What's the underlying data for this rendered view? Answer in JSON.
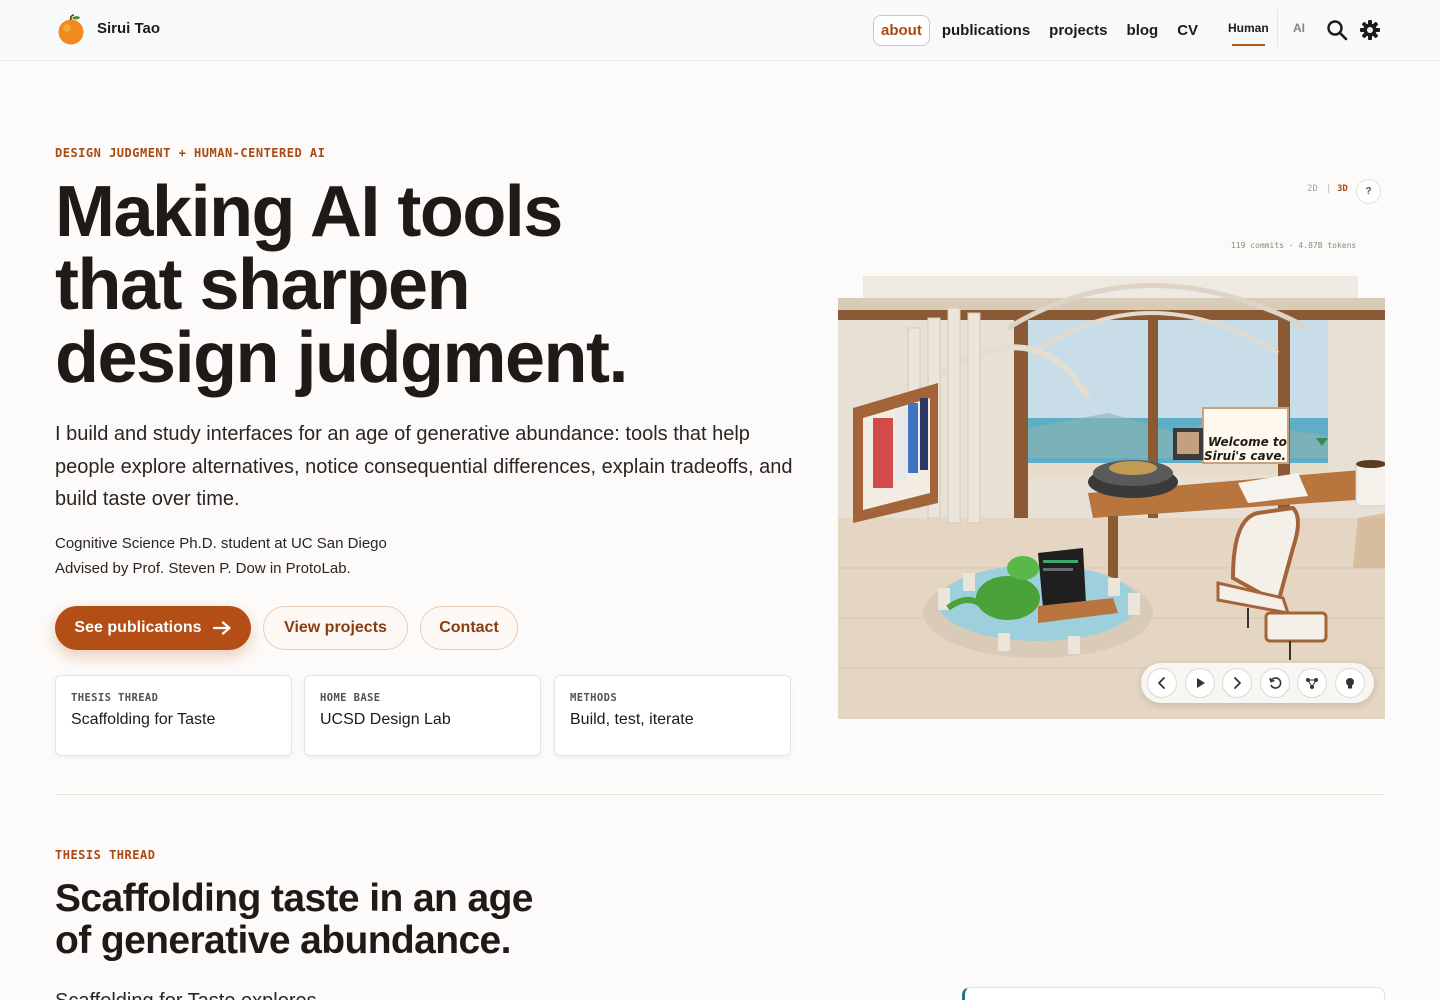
{
  "nav": {
    "brand": "Sirui Tao",
    "links": [
      {
        "label": "about",
        "active": true
      },
      {
        "label": "publications"
      },
      {
        "label": "projects"
      },
      {
        "label": "blog"
      },
      {
        "label": "CV"
      }
    ],
    "modes": {
      "human": "Human",
      "ai": "AI",
      "selected": "Human"
    },
    "icons": [
      "search-icon",
      "gear-icon"
    ]
  },
  "hero": {
    "eyebrow": "DESIGN JUDGMENT + HUMAN-CENTERED AI",
    "title_lines": [
      "Making AI tools",
      "that sharpen",
      "design judgment."
    ],
    "lead": "I build and study interfaces for an age of generative abundance: tools that help people explore alternatives, notice consequential differences, explain tradeoffs, and build taste over time.",
    "meta_line1": "Cognitive Science Ph.D. student at UC San Diego",
    "meta_line2": "Advised by Prof. Steven P. Dow in ProtoLab.",
    "buttons": {
      "primary": "See publications",
      "projects": "View projects",
      "contact": "Contact"
    },
    "cards": [
      {
        "label": "THESIS THREAD",
        "value": "Scaffolding for Taste"
      },
      {
        "label": "HOME BASE",
        "value": "UCSD Design Lab"
      },
      {
        "label": "METHODS",
        "value": "Build, test, iterate"
      }
    ]
  },
  "scene": {
    "toggle_2d": "2D",
    "toggle_sep": "|",
    "toggle_3d": "3D",
    "toggle_selected": "3D",
    "help": "?",
    "stats": "119 commits · 4.87B tokens",
    "sign_line1": "Welcome to",
    "sign_line2": "Sirui's cave.",
    "controls": [
      "prev-icon",
      "play-icon",
      "next-icon",
      "reset-icon",
      "graph-icon",
      "lightbulb-icon"
    ]
  },
  "section": {
    "eyebrow": "THESIS THREAD",
    "title_line1": "Scaffolding taste in an age",
    "title_line2": "of generative abundance.",
    "body_start": "Scaffolding for Taste explores..."
  },
  "colors": {
    "accent": "#b24e16",
    "accent_text": "#a84a12",
    "ink": "#1f1a17",
    "background": "#fdfbf9"
  }
}
